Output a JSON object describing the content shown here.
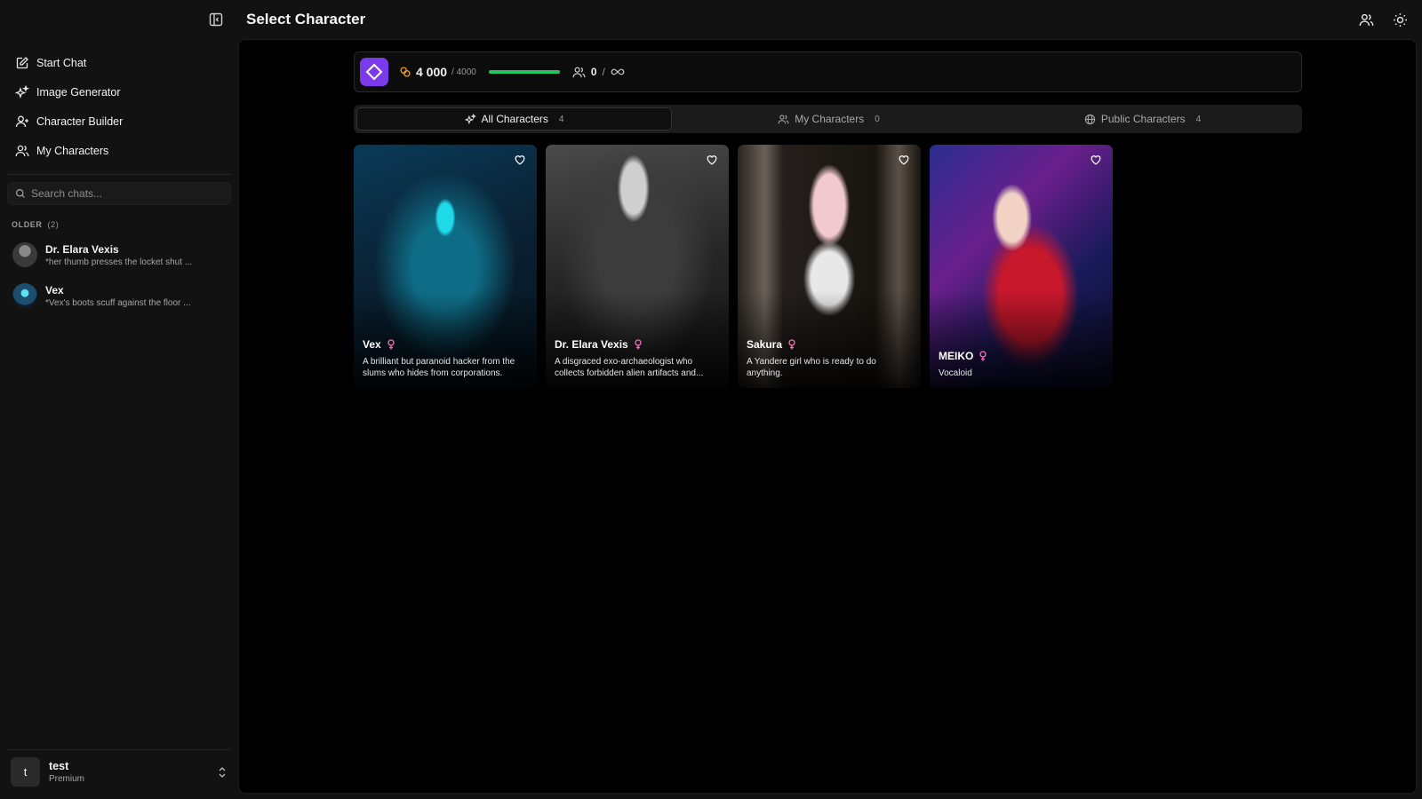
{
  "header": {
    "title": "Select Character"
  },
  "sidebar": {
    "nav": [
      {
        "label": "Start Chat",
        "icon": "edit-icon"
      },
      {
        "label": "Image Generator",
        "icon": "sparkles-icon"
      },
      {
        "label": "Character Builder",
        "icon": "user-plus-icon"
      },
      {
        "label": "My Characters",
        "icon": "users-icon"
      }
    ],
    "search_placeholder": "Search chats...",
    "group": {
      "label": "OLDER",
      "count": "(2)"
    },
    "chats": [
      {
        "title": "Dr. Elara Vexis",
        "preview": "*her thumb presses the locket shut ..."
      },
      {
        "title": "Vex",
        "preview": "*Vex's boots scuff against the floor ..."
      }
    ],
    "user": {
      "initial": "t",
      "name": "test",
      "plan": "Premium"
    }
  },
  "stats": {
    "coins": "4 000",
    "coins_max": "/ 4000",
    "coin_fill_fraction": 1.0,
    "people_count": "0",
    "people_sep": "/",
    "accent": "#7c3aed",
    "progress_color": "#22c55e"
  },
  "tabs": [
    {
      "label": "All Characters",
      "count": "4"
    },
    {
      "label": "My Characters",
      "count": "0"
    },
    {
      "label": "Public Characters",
      "count": "4"
    }
  ],
  "characters": [
    {
      "name": "Vex",
      "desc": "A brilliant but paranoid hacker from the slums who hides from corporations."
    },
    {
      "name": "Dr. Elara Vexis",
      "desc": "A disgraced exo-archaeologist who collects forbidden alien artifacts and..."
    },
    {
      "name": "Sakura",
      "desc": "A Yandere girl who is ready to do anything."
    },
    {
      "name": "MEIKO",
      "desc": "Vocaloid"
    }
  ]
}
